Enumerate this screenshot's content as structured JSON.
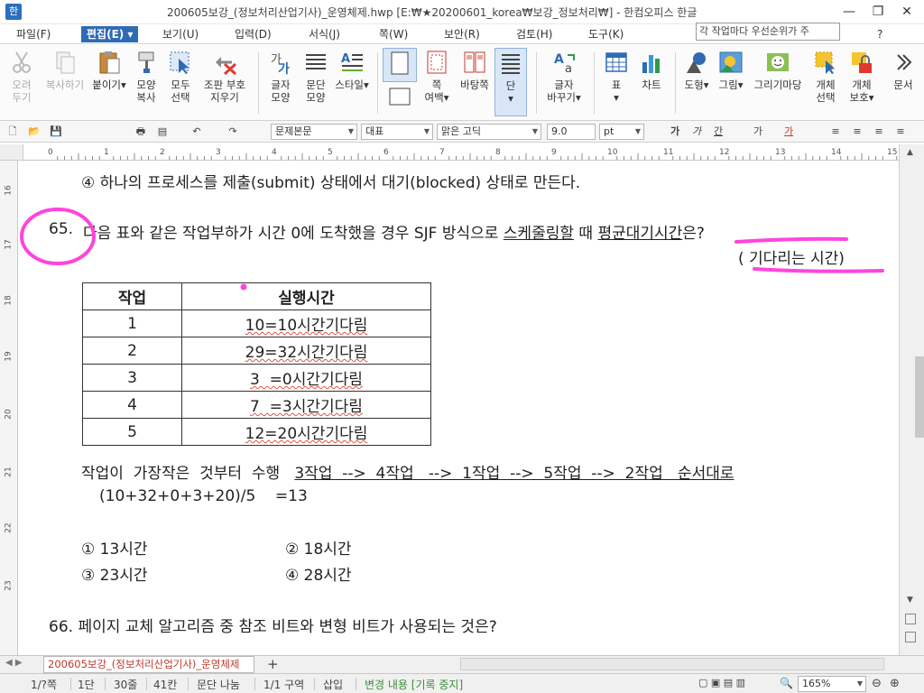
{
  "window": {
    "title": "200605보강_(정보처리산업기사)_운영체제.hwp [E:₩★20200601_korea₩보강_정보처리₩] - 한컴오피스 한글",
    "minimize": "—",
    "restore": "❐",
    "close": "✕"
  },
  "menu": {
    "items": [
      "파일(F)",
      "편집(E)",
      "보기(U)",
      "입력(D)",
      "서식(J)",
      "쪽(W)",
      "보안(R)",
      "검토(H)",
      "도구(K)"
    ],
    "search_value": "각 작업마다 우선순위가 주",
    "help": "?"
  },
  "ribbon": {
    "cut": [
      "오려",
      "두기"
    ],
    "copy": "복사하기",
    "paste": "붙이기",
    "format_copy": [
      "모양",
      "복사"
    ],
    "select_all": [
      "모두",
      "선택"
    ],
    "clear_format": [
      "조판 부호",
      "지우기"
    ],
    "char_shape": [
      "글자",
      "모양"
    ],
    "para_shape": [
      "문단",
      "모양"
    ],
    "style": "스타일",
    "page_margin": [
      "쪽",
      "여백"
    ],
    "background": "바탕쪽",
    "column": "단",
    "char_change": [
      "글자",
      "바꾸기"
    ],
    "table": "표",
    "chart": "차트",
    "shape": "도형",
    "picture": "그림",
    "draw_market": "그리기마당",
    "obj_select": [
      "개체",
      "선택"
    ],
    "obj_protect": [
      "개체",
      "보호"
    ],
    "more": "문서"
  },
  "format_bar": {
    "style": "문제본문",
    "lang": "대표",
    "font": "맑은 고딕",
    "size": "9.0",
    "unit": "pt"
  },
  "ruler_numbers": [
    "0",
    "1",
    "2",
    "3",
    "4",
    "5",
    "6",
    "7",
    "8",
    "9",
    "10",
    "11",
    "12",
    "13",
    "14",
    "15"
  ],
  "vruler_numbers": [
    "16",
    "17",
    "18",
    "19",
    "20",
    "21",
    "22",
    "23"
  ],
  "doc": {
    "prev_option": "④  하나의  프로세스를  제출(submit)  상태에서  대기(blocked)  상태로  만든다.",
    "q65_num": "65.",
    "q65_text_a": "다음  표와  같은  작업부하가  시간  0에  도착했을  경우  SJF  방식으로  ",
    "q65_text_b": "스케줄링할",
    "q65_text_c": "  때  ",
    "q65_text_d": "평균대기시간",
    "q65_text_e": "은?",
    "q65_note": "(  기다리는  시간)",
    "table_headers": [
      "작업",
      "실행시간"
    ],
    "table_rows": [
      [
        "1",
        "10=10시간기다림"
      ],
      [
        "2",
        "29=32시간기다림"
      ],
      [
        "3",
        "3  =0시간기다림"
      ],
      [
        "4",
        "7  =3시간기다림"
      ],
      [
        "5",
        "12=20시간기다림"
      ]
    ],
    "order_a": "작업이  가장작은  것부터  수행   ",
    "order_b": "3작업  -->  4작업   -->  1작업  -->  5작업  -->  2작업   순서대로",
    "calc": "(10+32+0+3+20)/5    =13",
    "opt1": "①  13시간",
    "opt2": "②  18시간",
    "opt3": "③  23시간",
    "opt4": "④  28시간",
    "q66": "66.  페이지  교체  알고리즘  중  참조  비트와  변형  비트가  사용되는  것은?"
  },
  "tabs": {
    "doc_tab": "200605보강_(정보처리산업기사)_운영체제",
    "add": "+"
  },
  "status": {
    "page": "1/?쪽",
    "column": "1단",
    "line": "30줄",
    "col": "41칸",
    "para_split": "문단 나눔",
    "section": "1/1 구역",
    "insert": "삽입",
    "track": "변경 내용 [기록 중지]",
    "zoom": "165%"
  },
  "colors": {
    "accent": "#2f6bb5",
    "annotation": "#ff44dd",
    "track_text": "#3a8f3a",
    "tab_text": "#c0392b"
  }
}
